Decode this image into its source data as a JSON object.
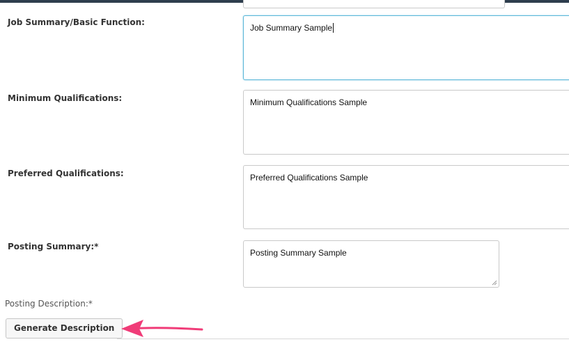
{
  "form": {
    "fields": [
      {
        "label": "Job Summary/Basic Function:",
        "value": "Job Summary Sample",
        "focused": true
      },
      {
        "label": "Minimum Qualifications:",
        "value": "Minimum Qualifications Sample"
      },
      {
        "label": "Preferred Qualifications:",
        "value": "Preferred Qualifications Sample"
      },
      {
        "label": "Posting Summary:*",
        "value": "Posting Summary Sample"
      }
    ],
    "posting_description_label": "Posting Description:*",
    "generate_button_label": "Generate Description"
  },
  "colors": {
    "header_bar": "#2e3e4e",
    "focus_border": "#5bb7d8",
    "annotation_arrow": "#f03c78"
  },
  "icons": {
    "annotation": "arrow-left-icon",
    "textarea_grip": "resize-grip-icon"
  }
}
